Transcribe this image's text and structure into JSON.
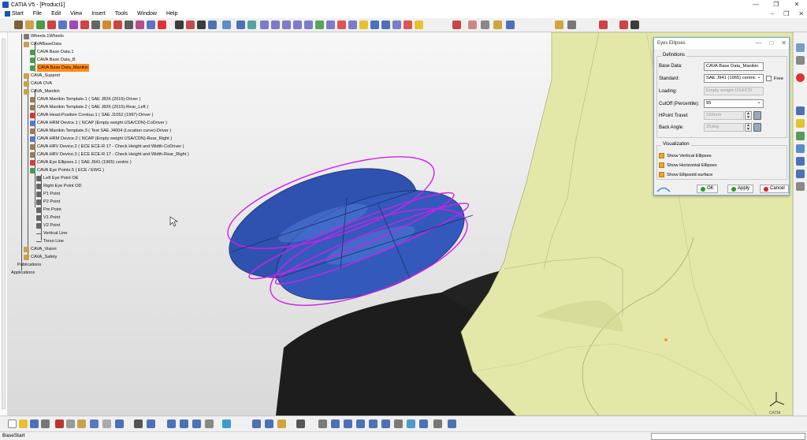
{
  "window": {
    "title": "CATIA V5 - [Product1]",
    "minimize": "—",
    "maximize": "❐",
    "close": "✕"
  },
  "menu": {
    "items": [
      "Start",
      "File",
      "Edit",
      "View",
      "Insert",
      "Tools",
      "Window",
      "Help"
    ],
    "right_min": "–",
    "right_restore": "❐",
    "right_close": "✕"
  },
  "tree": {
    "lines": [
      {
        "text": "Wheels.1Wheels"
      },
      {
        "text": "CAVABaseData"
      },
      {
        "text": "CAVA Base Data.1"
      },
      {
        "text": "CAVA Base Data_B"
      },
      {
        "text": "CAVA Base Data_Manikin"
      },
      {
        "text": "CAVA_Support"
      },
      {
        "text": "CAVA OVA"
      },
      {
        "text": "CAVA_Manikin"
      },
      {
        "text": "CAVA Manikin Template.1 ( SAE J826 (2015)-Driver )"
      },
      {
        "text": "CAVA Manikin Template.2 ( SAE J826 (2015)-Rear_Left )"
      },
      {
        "text": "CAVA Head-Position Contour.1 ( SAE J1052 (1997)-Driver )"
      },
      {
        "text": "CAVA HRM Device.1 ( NCAP (Empty weight USA/CDN)-CoDriver )"
      },
      {
        "text": "CAVA Manikin Template.3 ( Test SAE J4004 (Location curve)-Driver )"
      },
      {
        "text": "CAVA HRM Device.2 ( NCAP (Empty weight USA/CDN)-Rear_Right )"
      },
      {
        "text": "CAVA HRV Device.2 ( ECE ECE-R 17 - Check Height and Width-CoDriver )"
      },
      {
        "text": "CAVA HRV Device.3 ( ECE ECE-R 17 - Check Height and Width-Rear_Right )"
      },
      {
        "text": "CAVA Eye Ellipses.1 ( SAE J941 (1965) centric )"
      },
      {
        "text": "CAVA Eye Points.5 ( ECE / EWG )"
      },
      {
        "text": "Left Eye Point OE"
      },
      {
        "text": "Right Eye Point OD"
      },
      {
        "text": "P1 Point"
      },
      {
        "text": "P2 Point"
      },
      {
        "text": "Pm Point"
      },
      {
        "text": "V1 Point"
      },
      {
        "text": "V2 Point"
      },
      {
        "text": "Vertical Line"
      },
      {
        "text": "Torso Line"
      },
      {
        "text": "CAVA_Vision"
      },
      {
        "text": "CAVA_Safety"
      },
      {
        "text": "Publications"
      },
      {
        "text": "Applications"
      }
    ]
  },
  "dialog": {
    "title": "Eyes Ellipses",
    "ctrl_min": "—",
    "ctrl_max": "□",
    "ctrl_close": "✕",
    "definitions_label": "Definitions",
    "base_data_label": "Base Data:",
    "base_data_value": "CAVA Base Data_Manikin",
    "standard_label": "Standard:",
    "standard_value": "SAE J941 (1965) centric",
    "free_label": "Free",
    "free_checked": false,
    "loading_label": "Loading:",
    "loading_value": "Empty weight USA/CD",
    "cutoff_label": "CutOff (Percentile):",
    "cutoff_value": "95",
    "hpoint_label": "HPoint Travel:",
    "hpoint_value": "165mm",
    "back_angle_label": "Back Angle:",
    "back_angle_value": "25deg",
    "visualization_label": "Visualization",
    "show_vertical_label": "Show Vertical Ellipses",
    "show_horizontal_label": "Show Horizontal Ellipses",
    "show_surface_label": "Show Ellipsoid surface",
    "ok_label": "OK",
    "apply_label": "Apply",
    "cancel_label": "Cancel"
  },
  "status": {
    "text": "BaseStart",
    "command_value": ""
  },
  "colors": {
    "ellipsoid_fill": "#2f52b0",
    "ellipse_stroke": "#d21ee6",
    "seat_color": "#e3e8a8",
    "floor_color": "#1d1d1d",
    "selection_highlight": "#ff8c1a"
  },
  "compass_label": "CATIA"
}
